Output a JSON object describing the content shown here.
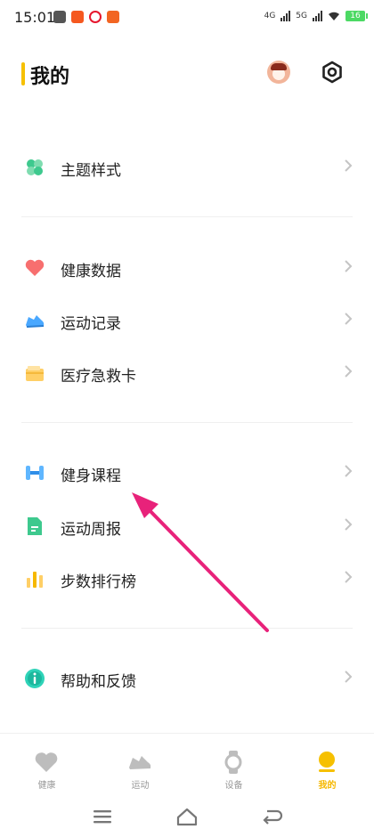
{
  "status_bar": {
    "time": "15:01",
    "net1": "4G",
    "net2": "5G",
    "battery": "16"
  },
  "header": {
    "title": "我的"
  },
  "menu": {
    "theme": "主题样式",
    "health_data": "健康数据",
    "exercise_record": "运动记录",
    "medical_card": "医疗急救卡",
    "fitness_course": "健身课程",
    "weekly_report": "运动周报",
    "step_ranking": "步数排行榜",
    "help_feedback": "帮助和反馈"
  },
  "bottom_nav": {
    "health": "健康",
    "exercise": "运动",
    "device": "设备",
    "mine": "我的"
  },
  "colors": {
    "accent": "#f6b800",
    "annotation_arrow": "#e8227a"
  }
}
